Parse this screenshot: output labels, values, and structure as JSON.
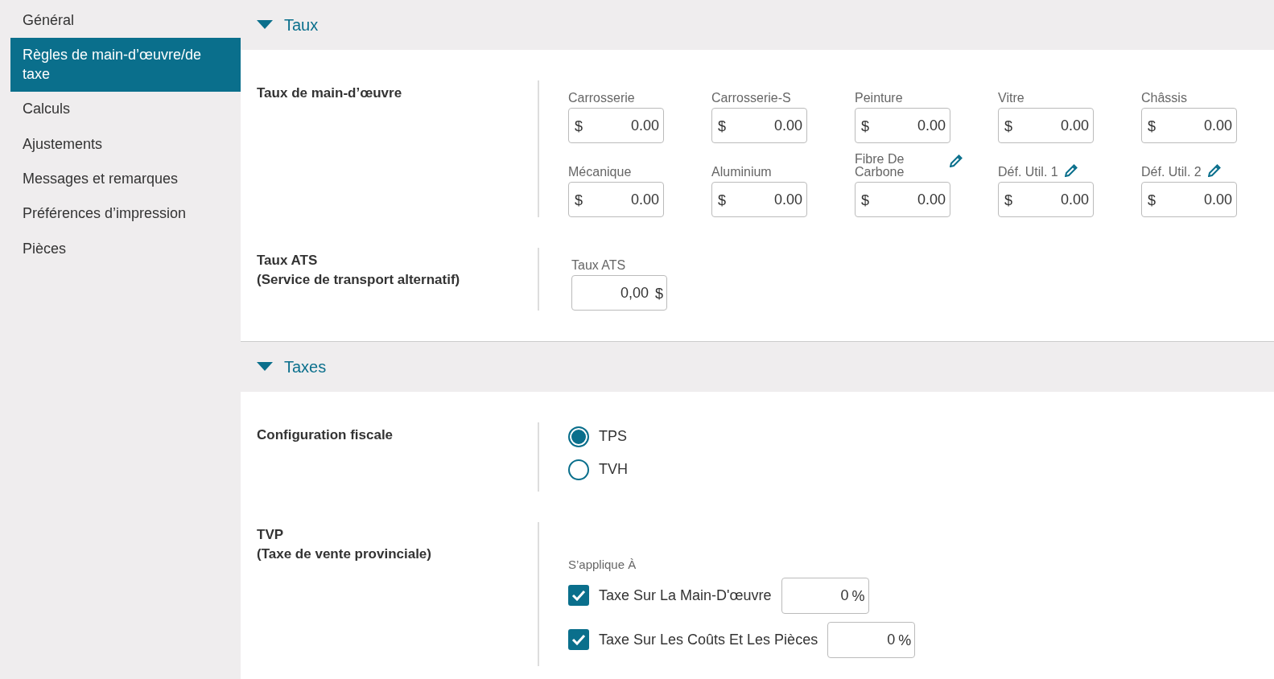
{
  "sidebar": {
    "items": [
      {
        "label": "Général",
        "selected": false
      },
      {
        "label": "Règles de main-d’œuvre/de taxe",
        "selected": true
      },
      {
        "label": "Calculs",
        "selected": false
      },
      {
        "label": "Ajustements",
        "selected": false
      },
      {
        "label": "Messages et remarques",
        "selected": false
      },
      {
        "label": "Préférences d’impression",
        "selected": false
      },
      {
        "label": "Pièces",
        "selected": false
      }
    ]
  },
  "sections": [
    {
      "title": "Taux",
      "expanded": true,
      "rows": [
        {
          "kind": "rates",
          "label": "Taux de main-d’œuvre",
          "fields": [
            {
              "label": "Carrosserie",
              "prefix": "$",
              "value": "0.00",
              "editable": false
            },
            {
              "label": "Carrosserie-S",
              "prefix": "$",
              "value": "0.00",
              "editable": false
            },
            {
              "label": "Peinture",
              "prefix": "$",
              "value": "0.00",
              "editable": false
            },
            {
              "label": "Vitre",
              "prefix": "$",
              "value": "0.00",
              "editable": false
            },
            {
              "label": "Châssis",
              "prefix": "$",
              "value": "0.00",
              "editable": false
            },
            {
              "label": "Mécanique",
              "prefix": "$",
              "value": "0.00",
              "editable": false
            },
            {
              "label": "Aluminium",
              "prefix": "$",
              "value": "0.00",
              "editable": false
            },
            {
              "label": "Fibre De Carbone",
              "prefix": "$",
              "value": "0.00",
              "editable": true
            },
            {
              "label": "Déf. Util. 1",
              "prefix": "$",
              "value": "0.00",
              "editable": true
            },
            {
              "label": "Déf. Util. 2",
              "prefix": "$",
              "value": "0.00",
              "editable": true
            }
          ]
        },
        {
          "kind": "rates",
          "label": "Taux ATS",
          "sublabel": "(Service de transport alternatif)",
          "fields": [
            {
              "label": "Taux ATS",
              "suffix": "$",
              "value": "0,00",
              "editable": false
            }
          ]
        }
      ]
    },
    {
      "title": "Taxes",
      "expanded": true,
      "rows": [
        {
          "kind": "radios",
          "label": "Configuration fiscale",
          "options": [
            {
              "label": "TPS",
              "selected": true
            },
            {
              "label": "TVH",
              "selected": false
            }
          ]
        },
        {
          "kind": "checks",
          "label": "TVP",
          "sublabel": "(Taxe de vente provinciale)",
          "caption": "S’applique À",
          "checks": [
            {
              "label": "Taxe Sur La Main-D'œuvre",
              "checked": true,
              "value": "0",
              "suffix": "%"
            },
            {
              "label": "Taxe Sur Les Coûts Et Les Pièces",
              "checked": true,
              "value": "0",
              "suffix": "%"
            }
          ]
        }
      ]
    }
  ]
}
